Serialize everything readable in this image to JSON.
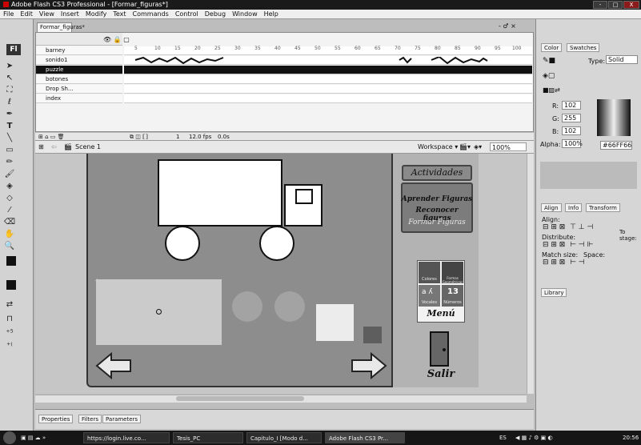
{
  "window": {
    "title": "Adobe Flash CS3 Professional - [Formar_figuras*]",
    "controls": [
      "-",
      "□",
      "X"
    ]
  },
  "menubar": [
    "File",
    "Edit",
    "View",
    "Insert",
    "Modify",
    "Text",
    "Commands",
    "Control",
    "Debug",
    "Window",
    "Help"
  ],
  "doc_tab": "Formar_figuras*",
  "doc_controls": "- ♂ ×",
  "timeline": {
    "layers": [
      {
        "name": "barney",
        "selected": false
      },
      {
        "name": "sonido1",
        "selected": false
      },
      {
        "name": "puzzle",
        "selected": true
      },
      {
        "name": "botones",
        "selected": false
      },
      {
        "name": "Drop Sh...",
        "selected": false
      },
      {
        "name": "index",
        "selected": false
      }
    ],
    "ruler": [
      "5",
      "10",
      "15",
      "20",
      "25",
      "30",
      "35",
      "40",
      "45",
      "50",
      "55",
      "60",
      "65",
      "70",
      "75",
      "80",
      "85",
      "90",
      "95",
      "100"
    ],
    "frame": "1",
    "fps": "12.0 fps",
    "time": "0.0s"
  },
  "editbar": {
    "scene": "Scene 1",
    "workspace": "Workspace ▾",
    "zoom": "100%"
  },
  "stage": {
    "actividades_title": "Actividades",
    "menu_items": [
      "Aprender Figuras",
      "Reconocer figuras",
      "Formar Figuras"
    ],
    "menu_tiles": [
      "Colores",
      "Formas Geométricas",
      "Vocales",
      "Números"
    ],
    "menu_label": "Menú",
    "salir_label": "Salir",
    "stage_color": "#8d8d8d"
  },
  "properties": {
    "tabs": [
      "Properties",
      "Filters",
      "Parameters"
    ]
  },
  "color_panel": {
    "tabs": [
      "Color",
      "Swatches"
    ],
    "type_label": "Type:",
    "type_value": "Solid",
    "r_label": "R:",
    "r": "102",
    "g_label": "G:",
    "g": "255",
    "b_label": "B:",
    "b": "102",
    "alpha_label": "Alpha:",
    "alpha": "100%",
    "hex": "#66FF66",
    "swatch": "#66ff66"
  },
  "align_panel": {
    "tabs": [
      "Align",
      "Info",
      "Transform"
    ],
    "align_label": "Align:",
    "distribute_label": "Distribute:",
    "match_label": "Match size:",
    "space_label": "Space:",
    "to_stage": "To stage:"
  },
  "library_tab": "Library",
  "taskbar": {
    "tasks": [
      "https://login.live.co...",
      "Tesis_PC",
      "Capitulo_I [Modo d...",
      "Adobe Flash CS3 Pr..."
    ],
    "lang": "ES",
    "clock": "20:56"
  }
}
